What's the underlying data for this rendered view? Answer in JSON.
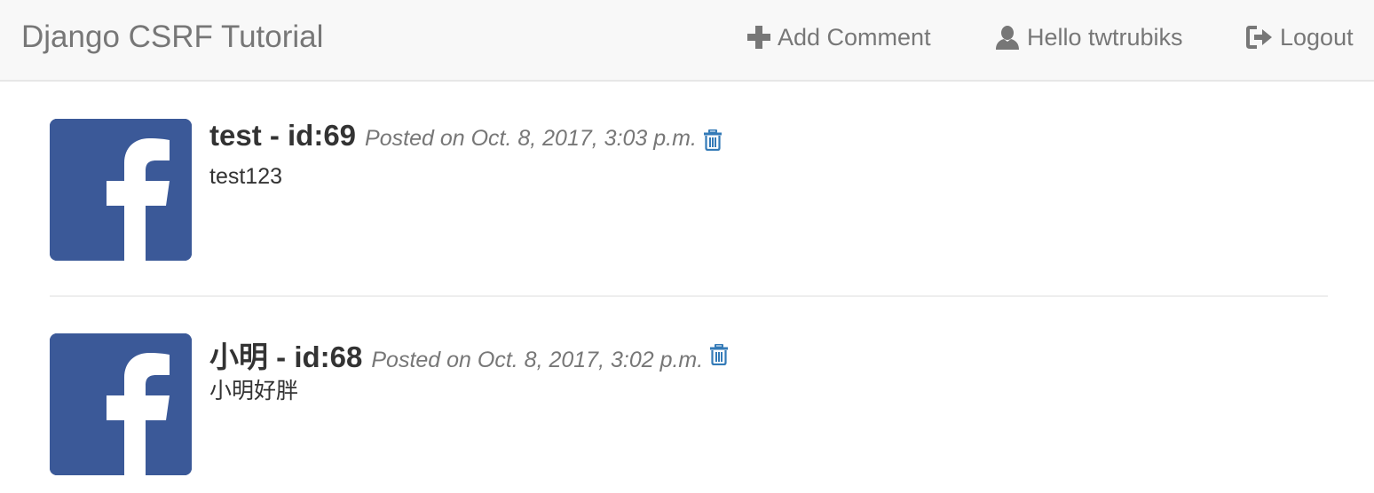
{
  "navbar": {
    "brand": "Django CSRF Tutorial",
    "add_comment": "Add Comment",
    "greeting": "Hello twtrubiks",
    "logout": "Logout"
  },
  "comments": [
    {
      "author": "test - id:69",
      "posted": "Posted on Oct. 8, 2017, 3:03 p.m.",
      "text": "test123"
    },
    {
      "author": "小明 - id:68",
      "posted": "Posted on Oct. 8, 2017, 3:02 p.m.",
      "text": "小明好胖"
    }
  ],
  "colors": {
    "navbar_bg": "#f8f8f8",
    "nav_text": "#777777",
    "facebook_blue": "#3b5998",
    "trash_icon": "#337ab7"
  },
  "icons": {
    "add": "plus-icon",
    "user": "user-icon",
    "logout": "logout-icon",
    "avatar": "facebook-icon",
    "delete": "trash-icon"
  }
}
